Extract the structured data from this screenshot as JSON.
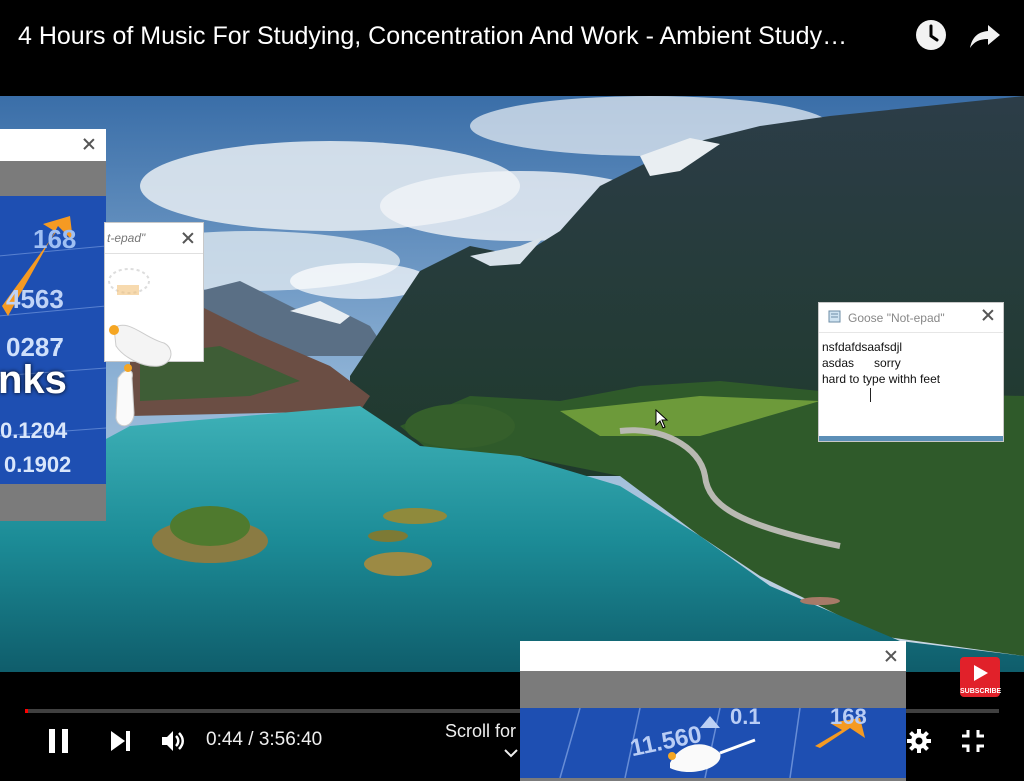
{
  "header": {
    "video_title": "4 Hours of Music For Studying, Concentration And Work - Ambient Study…",
    "watch_later_icon": "clock-icon",
    "share_icon": "share-arrow-icon"
  },
  "player": {
    "current_time": "0:44",
    "separator": " / ",
    "duration": "3:56:40",
    "time_display": "0:44 / 3:56:40",
    "progress_fraction": 0.0031,
    "scroll_hint": "Scroll for",
    "subscribe_label": "SUBSCRIBE",
    "colors": {
      "progress": "#ff0000",
      "subscribe": "#e1212a"
    }
  },
  "overlays": {
    "small_notepad_title": "t-epad\"",
    "goose_notepad": {
      "title": "Goose \"Not-epad\"",
      "lines": [
        "nsfdafdsaafsdjl",
        "asdas      sorry",
        "hard to type withh feet"
      ]
    },
    "thumbnail_texts": [
      "168",
      "4563",
      "0287",
      "nks",
      "0.1204",
      "0.1902"
    ],
    "bottom_thumbnail_texts": [
      "11.560",
      "0.1",
      "168"
    ]
  }
}
